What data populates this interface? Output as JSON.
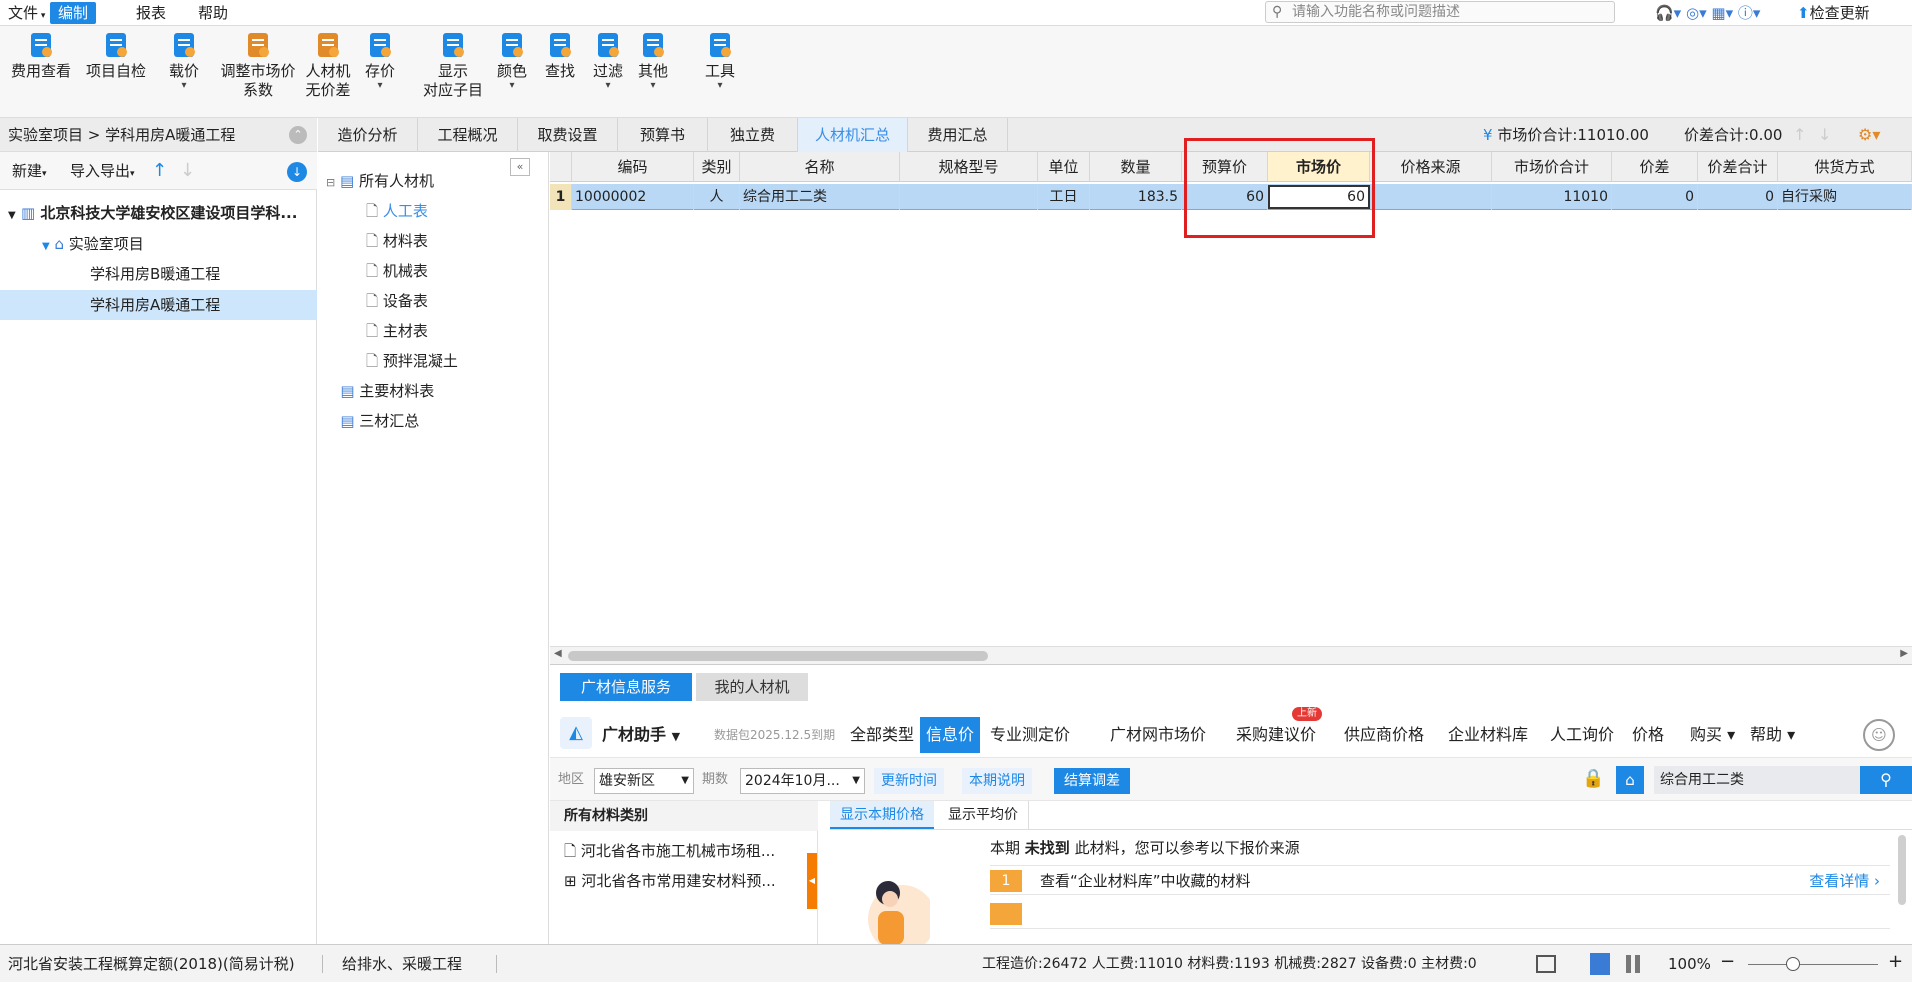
{
  "menubar": {
    "items": [
      "文件",
      "编制",
      "报表",
      "帮助"
    ],
    "search_placeholder": "请输入功能名称或问题描述",
    "check_update": "检查更新"
  },
  "ribbon": {
    "buttons": [
      {
        "label": "费用查看",
        "icon": "fee-view-icon"
      },
      {
        "label": "项目自检",
        "icon": "project-check-icon"
      },
      {
        "label": "载价",
        "icon": "load-price-icon"
      },
      {
        "label": "调整市场价\n系数",
        "icon": "adjust-coef-icon"
      },
      {
        "label": "人材机\n无价差",
        "icon": "balance-icon"
      },
      {
        "label": "存价",
        "icon": "save-price-icon"
      },
      {
        "label": "显示\n对应子目",
        "icon": "show-subitem-icon"
      },
      {
        "label": "颜色",
        "icon": "color-icon"
      },
      {
        "label": "查找",
        "icon": "find-icon"
      },
      {
        "label": "过滤",
        "icon": "filter-icon"
      },
      {
        "label": "其他",
        "icon": "other-icon"
      },
      {
        "label": "工具",
        "icon": "tools-icon"
      }
    ]
  },
  "left": {
    "breadcrumb": "实验室项目 > 学科用房A暖通工程",
    "new_label": "新建",
    "import_export_label": "导入导出",
    "tree": [
      {
        "label": "北京科技大学雄安校区建设项目学科...",
        "level": 0
      },
      {
        "label": "实验室项目",
        "level": 1
      },
      {
        "label": "学科用房B暖通工程",
        "level": 2
      },
      {
        "label": "学科用房A暖通工程",
        "level": 2,
        "selected": true
      }
    ]
  },
  "tabs": [
    "造价分析",
    "工程概况",
    "取费设置",
    "预算书",
    "独立费",
    "人材机汇总",
    "费用汇总"
  ],
  "summary": {
    "market_total": "市场价合计:11010.00",
    "diff_total": "价差合计:0.00"
  },
  "category_tree": [
    {
      "label": "所有人材机",
      "level": 0
    },
    {
      "label": "人工表",
      "level": 1,
      "selected": true
    },
    {
      "label": "材料表",
      "level": 1
    },
    {
      "label": "机械表",
      "level": 1
    },
    {
      "label": "设备表",
      "level": 1
    },
    {
      "label": "主材表",
      "level": 1
    },
    {
      "label": "预拌混凝土",
      "level": 1
    },
    {
      "label": "主要材料表",
      "level": 0
    },
    {
      "label": "三材汇总",
      "level": 0
    }
  ],
  "grid": {
    "columns": [
      "编码",
      "类别",
      "名称",
      "规格型号",
      "单位",
      "数量",
      "预算价",
      "市场价",
      "价格来源",
      "市场价合计",
      "价差",
      "价差合计",
      "供货方式"
    ],
    "rows": [
      {
        "no": "1",
        "cells": [
          "10000002",
          "人",
          "综合用工二类",
          "",
          "工日",
          "183.5",
          "60",
          "60",
          "",
          "11010",
          "0",
          "0",
          "自行采购"
        ]
      }
    ]
  },
  "bottom": {
    "tabs": [
      "广材信息服务",
      "我的人材机"
    ],
    "assistant": "广材助手",
    "package_note": "数据包2025.12.5到期",
    "nav": [
      "全部类型",
      "信息价",
      "专业测定价",
      "广材网市场价",
      "采购建议价",
      "供应商价格",
      "企业材料库",
      "人工询价",
      "价格",
      "购买",
      "帮助"
    ],
    "new_badge": "上新",
    "region_label": "地区",
    "region_value": "雄安新区",
    "period_label": "期数",
    "period_value": "2024年10月...",
    "update_time": "更新时间",
    "period_note": "本期说明",
    "settle_adjust": "结算调差",
    "search_value": "综合用工二类",
    "all_categories": "所有材料类别",
    "categories": [
      "河北省各市施工机械市场租...",
      "河北省各市常用建安材料预..."
    ],
    "subtabs": [
      "显示本期价格",
      "显示平均价"
    ],
    "notice_prefix": "本期",
    "notice_bold": "未找到",
    "notice_suffix": "此材料，您可以参考以下报价来源",
    "suggestion_no": "1",
    "suggestion": "查看“企业材料库”中收藏的材料",
    "suggestion_link": "查看详情"
  },
  "status": {
    "quota": "河北省安装工程概算定额(2018)(简易计税)",
    "specialty": "给排水、采暖工程",
    "totals": "工程造价:26472  人工费:11010  材料费:1193  机械费:2827  设备费:0  主材费:0",
    "zoom": "100%"
  },
  "colors": {
    "accent": "#1e88e5",
    "highlight_box": "#e02020",
    "selected_row": "#b9d8f5"
  }
}
